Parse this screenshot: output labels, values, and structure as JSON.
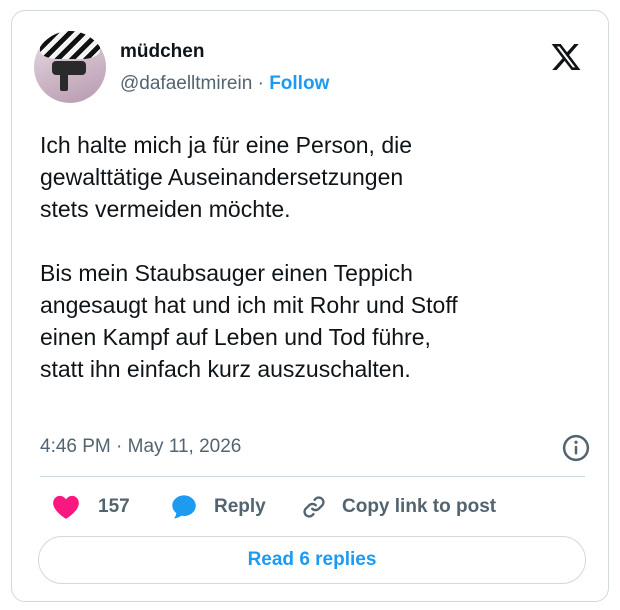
{
  "author": {
    "display_name": "müdchen",
    "handle": "@dafaelltmirein",
    "separator": "·",
    "follow_label": "Follow"
  },
  "tweet": {
    "paragraphs": [
      {
        "lines": [
          "Ich halte mich ja für eine Person, die",
          "gewalttätige Auseinandersetzungen",
          "stets vermeiden möchte."
        ]
      },
      {
        "lines": [
          "Bis mein Staubsauger einen Teppich",
          "angesaugt hat und ich mit Rohr und Stoff",
          "einen Kampf auf Leben und Tod führe,",
          "statt ihn einfach kurz auszuschalten."
        ]
      }
    ],
    "timestamp": "4:46 PM · May 11, 2026"
  },
  "actions": {
    "like_count": "157",
    "reply_label": "Reply",
    "copy_link_label": "Copy link to post",
    "read_replies_label": "Read 6 replies"
  },
  "icons": {
    "logo": "x-logo-icon",
    "info": "info-icon",
    "like": "heart-icon",
    "reply": "speech-bubble-icon",
    "copy": "link-icon"
  },
  "colors": {
    "accent": "#1d9bf0",
    "like": "#f91880",
    "text": "#0f1419",
    "secondary": "#536471",
    "border": "#cfd9de"
  }
}
